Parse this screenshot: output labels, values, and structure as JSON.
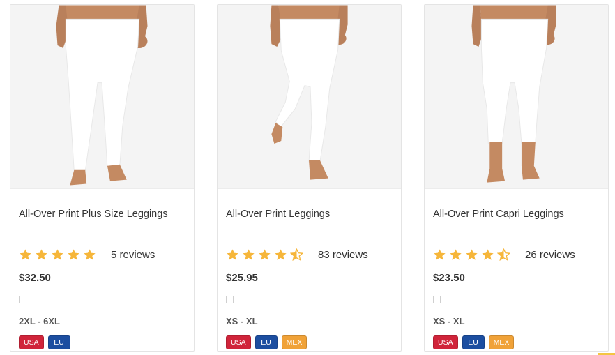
{
  "colors": {
    "star": "#f6b63a",
    "usa": "#d0243a",
    "eu": "#1c4ea0",
    "mex": "#f0a238"
  },
  "products": [
    {
      "title": "All-Over Print Plus Size Leggings",
      "rating": 5,
      "reviews": "5 reviews",
      "price": "$32.50",
      "sizes": "2XL - 6XL",
      "regions": [
        "USA",
        "EU"
      ],
      "image_icon": "leggings-photo"
    },
    {
      "title": "All-Over Print Leggings",
      "rating": 4.5,
      "reviews": "83 reviews",
      "price": "$25.95",
      "sizes": "XS - XL",
      "regions": [
        "USA",
        "EU",
        "MEX"
      ],
      "image_icon": "leggings-photo"
    },
    {
      "title": "All-Over Print Capri Leggings",
      "rating": 4.5,
      "reviews": "26 reviews",
      "price": "$23.50",
      "sizes": "XS - XL",
      "regions": [
        "USA",
        "EU",
        "MEX"
      ],
      "image_icon": "capri-leggings-photo"
    }
  ]
}
